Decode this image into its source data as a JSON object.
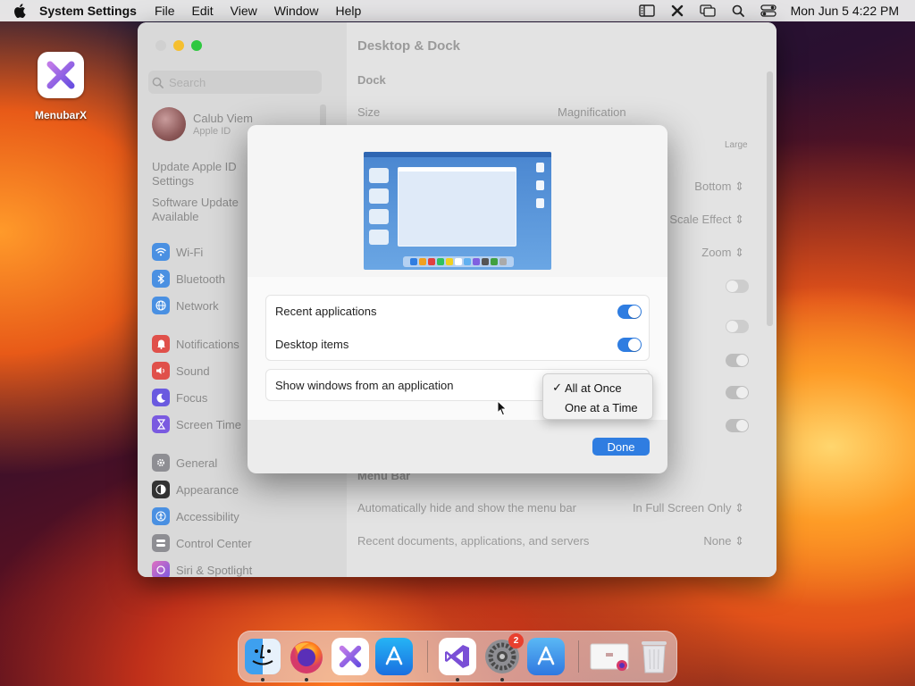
{
  "menubar": {
    "app_name": "System Settings",
    "items": [
      "File",
      "Edit",
      "View",
      "Window",
      "Help"
    ],
    "clock": "Mon Jun 5  4:22 PM"
  },
  "desktop": {
    "icon_label": "MenubarX"
  },
  "window": {
    "search_placeholder": "Search",
    "profile": {
      "name": "Calub Viem",
      "subtitle": "Apple ID"
    },
    "sidebar_links": [
      "Update Apple ID Settings",
      "Software Update Available"
    ],
    "sidebar_items": [
      {
        "label": "Wi-Fi",
        "icon": "wifi-icon",
        "color": "#4a90e2"
      },
      {
        "label": "Bluetooth",
        "icon": "bluetooth-icon",
        "color": "#4a90e2"
      },
      {
        "label": "Network",
        "icon": "globe-icon",
        "color": "#4a90e2"
      },
      {
        "label": "Notifications",
        "icon": "bell-icon",
        "color": "#e0504a"
      },
      {
        "label": "Sound",
        "icon": "speaker-icon",
        "color": "#e0504a"
      },
      {
        "label": "Focus",
        "icon": "moon-icon",
        "color": "#6a5ae0"
      },
      {
        "label": "Screen Time",
        "icon": "hourglass-icon",
        "color": "#7a5ae0"
      },
      {
        "label": "General",
        "icon": "gear-icon",
        "color": "#8e8e93"
      },
      {
        "label": "Appearance",
        "icon": "appearance-icon",
        "color": "#333333"
      },
      {
        "label": "Accessibility",
        "icon": "accessibility-icon",
        "color": "#4a90e2"
      },
      {
        "label": "Control Center",
        "icon": "control-center-icon",
        "color": "#8e8e93"
      },
      {
        "label": "Siri & Spotlight",
        "icon": "siri-icon",
        "color": "#c060d0"
      }
    ],
    "main": {
      "title": "Desktop & Dock",
      "dock_section": "Dock",
      "size_label": "Size",
      "magnification_label": "Magnification",
      "large_label": "Large",
      "position_value": "Bottom",
      "minimize_value": "Scale Effect",
      "double_click_value": "Zoom",
      "menubar_section": "Menu Bar",
      "autohide_label": "Automatically hide and show the menu bar",
      "autohide_value": "In Full Screen Only",
      "recent_docs_label": "Recent documents, applications, and servers",
      "recent_docs_value": "None"
    }
  },
  "sheet": {
    "rows": {
      "recent_apps": "Recent applications",
      "desktop_items": "Desktop items",
      "show_windows": "Show windows from an application"
    },
    "toggles": {
      "recent_apps": true,
      "desktop_items": true
    },
    "done_label": "Done",
    "popup": {
      "options": [
        "All at Once",
        "One at a Time"
      ],
      "selected": "All at Once",
      "check_mark": "✓"
    }
  },
  "dock": {
    "apps": [
      "Finder",
      "Firefox",
      "MenubarX",
      "App Store",
      "Visual Studio",
      "System Settings",
      "App Store",
      "Window Preview",
      "Trash"
    ],
    "badge_count": "2"
  },
  "colors": {
    "accent": "#2f7de1",
    "badge": "#e8402f"
  }
}
